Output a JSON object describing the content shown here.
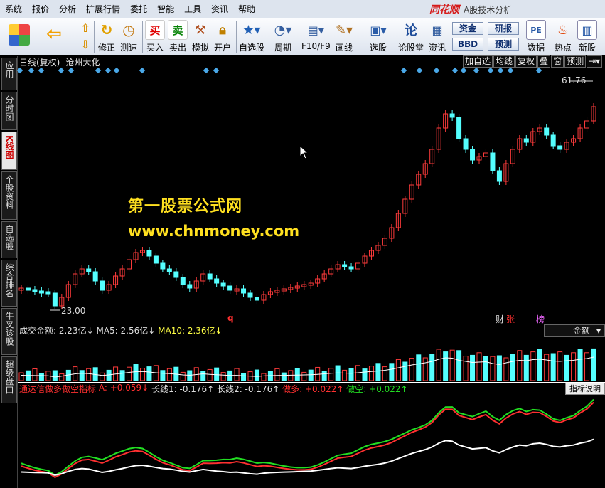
{
  "menubar": {
    "items": [
      "系统",
      "报价",
      "分析",
      "扩展行情",
      "委托",
      "智能",
      "工具",
      "资讯",
      "帮助"
    ],
    "brand_logo": "同花顺",
    "brand_title": "A股技术分析"
  },
  "toolbar": {
    "buttons": [
      {
        "label": "修正",
        "icon": "refresh-icon"
      },
      {
        "label": "测速",
        "icon": "clock-icon"
      },
      {
        "label": "买入",
        "icon": "buy-icon",
        "glyph": "买"
      },
      {
        "label": "卖出",
        "icon": "sell-icon",
        "glyph": "卖"
      },
      {
        "label": "模拟",
        "icon": "hammer-icon"
      },
      {
        "label": "开户",
        "icon": "lock-icon"
      },
      {
        "label": "自选股",
        "icon": "star-folder-icon"
      },
      {
        "label": "周期",
        "icon": "cycle-icon"
      },
      {
        "label": "F10/F9",
        "icon": "f10-icon"
      },
      {
        "label": "画线",
        "icon": "pencil-icon"
      },
      {
        "label": "选股",
        "icon": "select-stock-icon"
      },
      {
        "label": "论股堂",
        "icon": "forum-icon",
        "glyph": "论"
      },
      {
        "label": "资讯",
        "icon": "news-icon"
      },
      {
        "label": "数据",
        "icon": "pe-icon",
        "glyph": "PE"
      },
      {
        "label": "热点",
        "icon": "hot-icon"
      },
      {
        "label": "新股",
        "icon": "new-stock-icon"
      }
    ],
    "small_buttons": [
      "资金",
      "研报",
      "BBD",
      "预测"
    ]
  },
  "sidebar": {
    "tabs": [
      "应用",
      "分时图",
      "K线图",
      "个股资料",
      "自选股",
      "综合排名",
      "牛叉诊股",
      "超级盘口"
    ],
    "active": "K线图"
  },
  "chart": {
    "period": "日线(复权)",
    "stock_name": "沧州大化",
    "tools": [
      "加自选",
      "均线",
      "复权",
      "叠",
      "窗",
      "预测"
    ],
    "high_label": "61.76",
    "low_label": "23.00",
    "q_marker": "q",
    "flags": {
      "cai": "财",
      "zhang": "张",
      "bang": "榜"
    }
  },
  "watermark": {
    "line1": "第一股票公式网",
    "line2": "www.chnmoney.com"
  },
  "volume": {
    "label": "成交金额: 2.23亿↓",
    "ma5": "MA5: 2.56亿↓",
    "ma10": "MA10: 2.36亿↓",
    "selector": "金额"
  },
  "indicator": {
    "name": "通达信做多做空指标",
    "a": "A: +0.059↓",
    "l1": "长线1: -0.176↑",
    "l2": "长线2: -0.176↑",
    "duo": "做多: +0.022↑",
    "kong": "做空: +0.022↑",
    "help": "指标说明"
  },
  "colors": {
    "up": "#ff3b3b",
    "down": "#54ffff",
    "ma_white": "#ffffff",
    "ma_yellow": "#ffff44",
    "green": "#22dd22"
  }
}
